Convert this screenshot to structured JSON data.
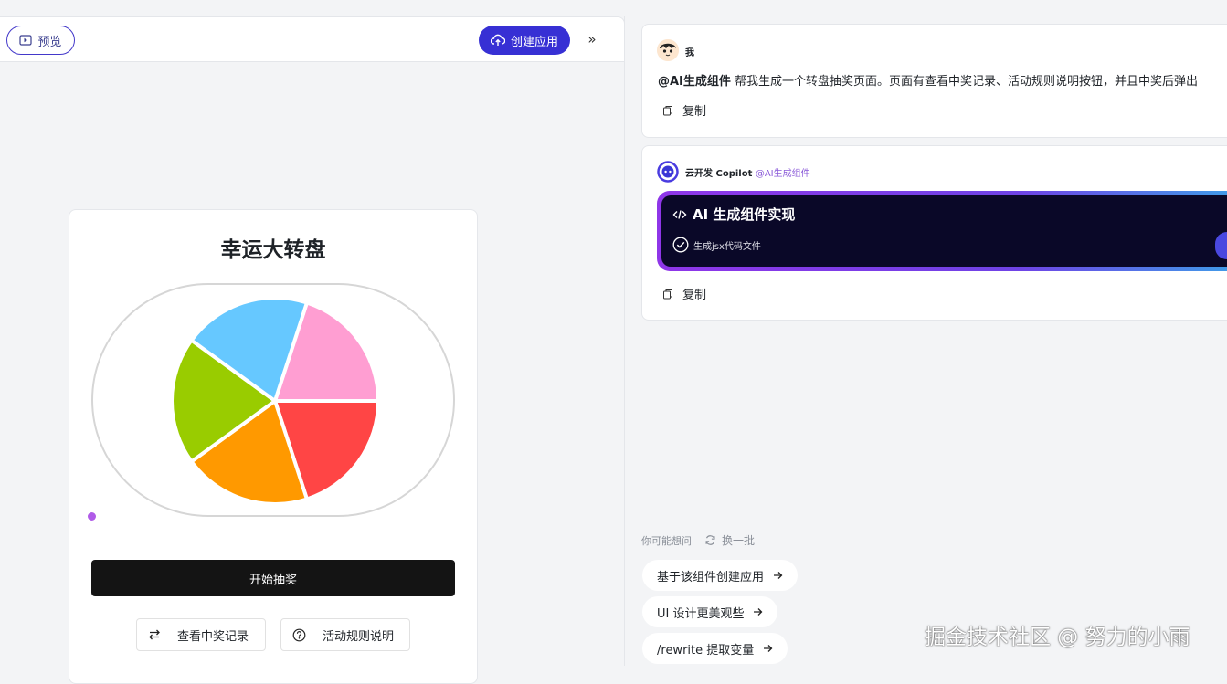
{
  "toolbar": {
    "preview_label": "预览",
    "create_app_label": "创建应用",
    "expand_icon": "»"
  },
  "preview": {
    "title": "幸运大转盘",
    "wheel_segments": [
      {
        "color": "#ff9ed2"
      },
      {
        "color": "#ff4545"
      },
      {
        "color": "#ff9900"
      },
      {
        "color": "#99cc00"
      },
      {
        "color": "#66c8ff"
      }
    ],
    "start_label": "开始抽奖",
    "records_label": "查看中奖记录",
    "rules_label": "活动规则说明"
  },
  "chat": {
    "user": {
      "name": "我",
      "mention": "@AI生成组件",
      "text": " 帮我生成一个转盘抽奖页面。页面有查看中奖记录、活动规则说明按钮，并且中奖后弹出",
      "copy_label": "复制"
    },
    "bot": {
      "name": "云开发 Copilot",
      "mention": "@AI生成组件",
      "card_title": "AI 生成组件实现",
      "card_step": "生成jsx代码文件",
      "copy_label": "复制"
    }
  },
  "suggestions": {
    "header": "你可能想问",
    "refresh_label": "换一批",
    "items": [
      {
        "label": "基于该组件创建应用"
      },
      {
        "label": "UI 设计更美观些"
      },
      {
        "label": "/rewrite 提取变量"
      }
    ]
  },
  "watermark": "掘金技术社区 @ 努力的小雨"
}
